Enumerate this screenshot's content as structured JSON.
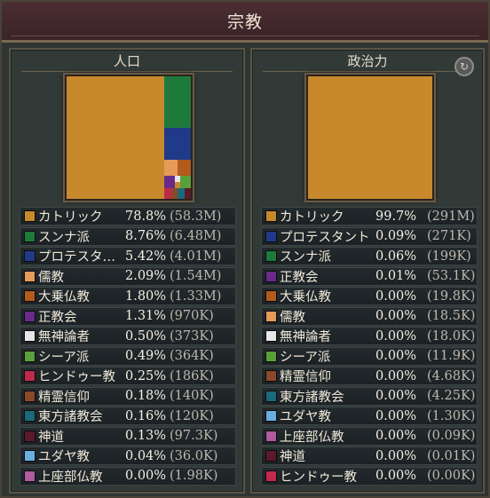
{
  "window": {
    "title": "宗教"
  },
  "left": {
    "title": "人口",
    "rows": [
      {
        "name": "カトリック",
        "pct": "78.8%",
        "abs": "(58.3M)",
        "color": "#c8892c"
      },
      {
        "name": "スンナ派",
        "pct": "8.76%",
        "abs": "(6.48M)",
        "color": "#1e7a3a"
      },
      {
        "name": "プロテスタ…",
        "pct": "5.42%",
        "abs": "(4.01M)",
        "color": "#203a8a"
      },
      {
        "name": "儒教",
        "pct": "2.09%",
        "abs": "(1.54M)",
        "color": "#e59a5a"
      },
      {
        "name": "大乗仏教",
        "pct": "1.80%",
        "abs": "(1.33M)",
        "color": "#b35a1c"
      },
      {
        "name": "正教会",
        "pct": "1.31%",
        "abs": "(970K)",
        "color": "#6a2a8a"
      },
      {
        "name": "無神論者",
        "pct": "0.50%",
        "abs": "(373K)",
        "color": "#e6e6e6"
      },
      {
        "name": "シーア派",
        "pct": "0.49%",
        "abs": "(364K)",
        "color": "#5aa03a"
      },
      {
        "name": "ヒンドゥー教",
        "pct": "0.25%",
        "abs": "(186K)",
        "color": "#c02a4a"
      },
      {
        "name": "精霊信仰",
        "pct": "0.18%",
        "abs": "(140K)",
        "color": "#8a4a2a"
      },
      {
        "name": "東方諸教会",
        "pct": "0.16%",
        "abs": "(120K)",
        "color": "#1a6a7a"
      },
      {
        "name": "神道",
        "pct": "0.13%",
        "abs": "(97.3K)",
        "color": "#5a1a2a"
      },
      {
        "name": "ユダヤ教",
        "pct": "0.04%",
        "abs": "(36.0K)",
        "color": "#6aaee0"
      },
      {
        "name": "上座部仏教",
        "pct": "0.00%",
        "abs": "(1.98K)",
        "color": "#b05aa0"
      }
    ]
  },
  "right": {
    "title": "政治力",
    "gear_icon": "cycle-icon",
    "rows": [
      {
        "name": "カトリック",
        "pct": "99.7%",
        "abs": "(291M)",
        "color": "#c8892c"
      },
      {
        "name": "プロテスタント",
        "pct": "0.09%",
        "abs": "(271K)",
        "color": "#203a8a"
      },
      {
        "name": "スンナ派",
        "pct": "0.06%",
        "abs": "(199K)",
        "color": "#1e7a3a"
      },
      {
        "name": "正教会",
        "pct": "0.01%",
        "abs": "(53.1K)",
        "color": "#6a2a8a"
      },
      {
        "name": "大乗仏教",
        "pct": "0.00%",
        "abs": "(19.8K)",
        "color": "#b35a1c"
      },
      {
        "name": "儒教",
        "pct": "0.00%",
        "abs": "(18.5K)",
        "color": "#e59a5a"
      },
      {
        "name": "無神論者",
        "pct": "0.00%",
        "abs": "(18.0K)",
        "color": "#e6e6e6"
      },
      {
        "name": "シーア派",
        "pct": "0.00%",
        "abs": "(11.9K)",
        "color": "#5aa03a"
      },
      {
        "name": "精霊信仰",
        "pct": "0.00%",
        "abs": "(4.68K)",
        "color": "#8a4a2a"
      },
      {
        "name": "東方諸教会",
        "pct": "0.00%",
        "abs": "(4.25K)",
        "color": "#1a6a7a"
      },
      {
        "name": "ユダヤ教",
        "pct": "0.00%",
        "abs": "(1.30K)",
        "color": "#6aaee0"
      },
      {
        "name": "上座部仏教",
        "pct": "0.00%",
        "abs": "(0.09K)",
        "color": "#b05aa0"
      },
      {
        "name": "神道",
        "pct": "0.00%",
        "abs": "(0.01K)",
        "color": "#5a1a2a"
      },
      {
        "name": "ヒンドゥー教",
        "pct": "0.00%",
        "abs": "(0.00K)",
        "color": "#c02a4a"
      }
    ]
  }
}
